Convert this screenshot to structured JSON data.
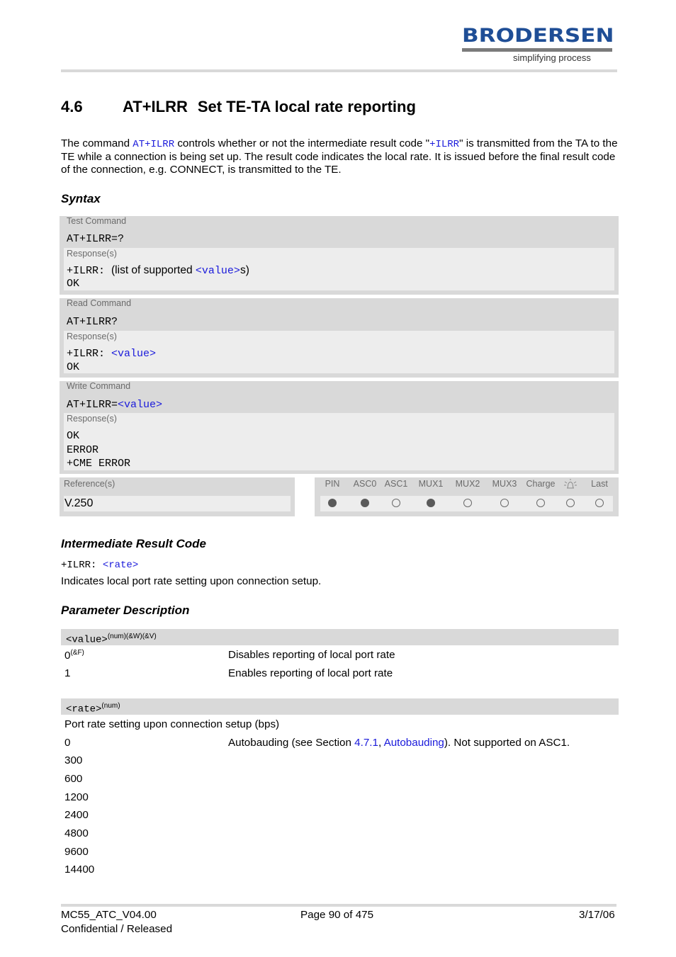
{
  "header": {
    "logo_text": "BRODERSEN",
    "logo_tagline": "simplifying process"
  },
  "section": {
    "number": "4.6",
    "command": "AT+ILRR",
    "title": "Set TE-TA local rate reporting"
  },
  "intro": {
    "p1": "The command ",
    "cmd_link": "AT+ILRR",
    "p2": " controls whether or not the intermediate result code \"",
    "urc_link": "+ILRR",
    "p3": "\" is transmitted from the TA to the TE while a connection is being set up. The result code indicates the local rate. It is issued before the final result code of the connection, e.g. CONNECT, is transmitted to the TE."
  },
  "syntax": {
    "heading": "Syntax",
    "test": {
      "label": "Test Command",
      "command": "AT+ILRR=?",
      "response_label": "Response(s)",
      "response_prefix": "+ILRR: ",
      "response_text_a": " (list of supported ",
      "response_param": "<value>",
      "response_text_b": "s)",
      "response_ok": "OK"
    },
    "read": {
      "label": "Read Command",
      "command": "AT+ILRR?",
      "response_label": "Response(s)",
      "response_prefix": "+ILRR: ",
      "response_param": "<value>",
      "response_ok": "OK"
    },
    "write": {
      "label": "Write Command",
      "command_prefix": "AT+ILRR=",
      "command_param": "<value>",
      "response_label": "Response(s)",
      "responses": [
        "OK",
        "ERROR",
        "+CME ERROR"
      ]
    },
    "reference": {
      "label": "Reference(s)",
      "value": "V.250"
    },
    "modes": [
      {
        "label": "PIN",
        "supported": true
      },
      {
        "label": "ASC0",
        "supported": true
      },
      {
        "label": "ASC1",
        "supported": false
      },
      {
        "label": "MUX1",
        "supported": true
      },
      {
        "label": "MUX2",
        "supported": false
      },
      {
        "label": "MUX3",
        "supported": false
      },
      {
        "label": "Charge",
        "supported": false
      },
      {
        "label": "alarm-icon",
        "supported": false
      },
      {
        "label": "Last",
        "supported": false
      }
    ]
  },
  "urc": {
    "heading": "Intermediate Result Code",
    "prefix": "+ILRR: ",
    "param": "<rate>",
    "description": "Indicates local port rate setting upon connection setup."
  },
  "params": {
    "heading": "Parameter Description",
    "value": {
      "name": "<value>",
      "attrs": "(num)(&W)(&V)",
      "rows": [
        {
          "key": "0",
          "sup": "(&F)",
          "desc": "Disables reporting of local port rate"
        },
        {
          "key": "1",
          "sup": "",
          "desc": "Enables reporting of local port rate"
        }
      ]
    },
    "rate": {
      "name": "<rate>",
      "attrs": "(num)",
      "intro": "Port rate setting upon connection setup (bps)",
      "row0_key": "0",
      "row0_desc_a": "Autobauding (see Section ",
      "row0_link1": "4.7.1",
      "row0_sep": ", ",
      "row0_link2": "Autobauding",
      "row0_desc_b": "). Not supported on ASC1.",
      "values": [
        "300",
        "600",
        "1200",
        "2400",
        "4800",
        "9600",
        "14400"
      ]
    }
  },
  "footer": {
    "doc_id": "MC55_ATC_V04.00",
    "page": "Page 90 of 475",
    "date": "3/17/06",
    "status": "Confidential / Released"
  }
}
